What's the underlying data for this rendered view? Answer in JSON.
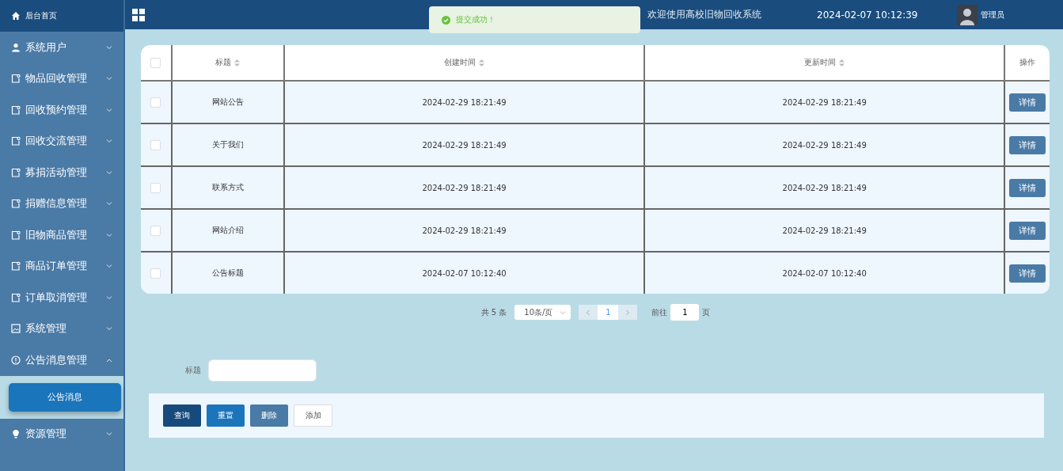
{
  "sidebar": {
    "home": {
      "label": "后台首页",
      "kind": "home"
    },
    "items": [
      {
        "label": "系统用户",
        "kind": "user",
        "expanded": false
      },
      {
        "label": "物品回收管理",
        "kind": "note",
        "expanded": false
      },
      {
        "label": "回收预约管理",
        "kind": "note",
        "expanded": false
      },
      {
        "label": "回收交流管理",
        "kind": "note",
        "expanded": false
      },
      {
        "label": "募捐活动管理",
        "kind": "note",
        "expanded": false
      },
      {
        "label": "捐赠信息管理",
        "kind": "note",
        "expanded": false
      },
      {
        "label": "旧物商品管理",
        "kind": "note",
        "expanded": false
      },
      {
        "label": "商品订单管理",
        "kind": "note",
        "expanded": false
      },
      {
        "label": "订单取消管理",
        "kind": "note",
        "expanded": false
      },
      {
        "label": "系统管理",
        "kind": "image",
        "expanded": false
      },
      {
        "label": "公告消息管理",
        "kind": "info",
        "expanded": true,
        "children": [
          {
            "label": "公告消息",
            "selected": true
          }
        ]
      },
      {
        "label": "资源管理",
        "kind": "bulb",
        "expanded": false
      }
    ]
  },
  "header": {
    "title": "欢迎使用高校旧物回收系统",
    "datetime": "2024-02-07 10:12:39",
    "user": "管理员"
  },
  "toast": {
    "message": "提交成功！"
  },
  "table": {
    "all_checked": false,
    "columns": [
      {
        "label": "标题",
        "sortable": true
      },
      {
        "label": "创建时间",
        "sortable": true
      },
      {
        "label": "更新时间",
        "sortable": true
      },
      {
        "label": "操作",
        "sortable": false
      }
    ],
    "rows": [
      {
        "checked": false,
        "title": "网站公告",
        "created": "2024-02-29 18:21:49",
        "updated": "2024-02-29 18:21:49",
        "action": "详情"
      },
      {
        "checked": false,
        "title": "关于我们",
        "created": "2024-02-29 18:21:49",
        "updated": "2024-02-29 18:21:49",
        "action": "详情"
      },
      {
        "checked": false,
        "title": "联系方式",
        "created": "2024-02-29 18:21:49",
        "updated": "2024-02-29 18:21:49",
        "action": "详情"
      },
      {
        "checked": false,
        "title": "网站介绍",
        "created": "2024-02-29 18:21:49",
        "updated": "2024-02-29 18:21:49",
        "action": "详情"
      },
      {
        "checked": false,
        "title": "公告标题",
        "created": "2024-02-07 10:12:40",
        "updated": "2024-02-07 10:12:40",
        "action": "详情"
      }
    ]
  },
  "pagination": {
    "total": "共 5 条",
    "page_size": "10条/页",
    "pages": [
      {
        "label": "1",
        "selected": true
      }
    ],
    "goto_label": "前往",
    "goto_value": "1",
    "goto_suffix": "页"
  },
  "search": {
    "label": "标题"
  },
  "buttons": [
    {
      "label": "查询",
      "kind": "query"
    },
    {
      "label": "重置",
      "kind": "reset"
    },
    {
      "label": "删除",
      "kind": "delete"
    },
    {
      "label": "添加",
      "kind": "add"
    }
  ]
}
